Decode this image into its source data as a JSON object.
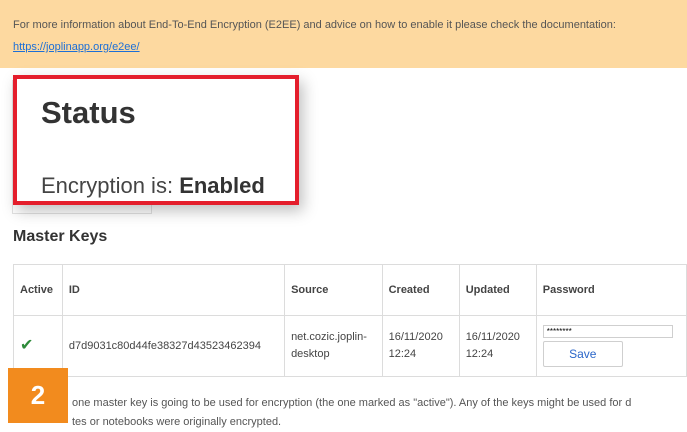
{
  "banner": {
    "text": "For more information about End-To-End Encryption (E2EE) and advice on how to enable it please check the documentation:",
    "link": "https://joplinapp.org/e2ee/"
  },
  "status": {
    "title": "Status",
    "encryption_label": "Encryption is:",
    "encryption_value": "Enabled"
  },
  "master_keys": {
    "title": "Master Keys",
    "columns": [
      "Active",
      "ID",
      "Source",
      "Created",
      "Updated",
      "Password"
    ],
    "row": {
      "active_icon": "check-icon",
      "active_glyph": "✔",
      "id": "d7d9031c80d44fe38327d435234623 94",
      "id_full": "d7d9031c80d44fe38327d43523462394",
      "source": "net.cozic.joplin-desktop",
      "created": "16/11/2020 12:24",
      "updated": "16/11/2020 12:24",
      "password_value": "********",
      "save_label": "Save"
    }
  },
  "footnote": {
    "line1": "one master key is going to be used for encryption (the one marked as \"active\"). Any of the keys might be used for d",
    "line2": "tes or notebooks were originally encrypted."
  },
  "badge": {
    "number": "2"
  },
  "colors": {
    "banner_bg": "#fdd9a0",
    "highlight_border": "#e41e2c",
    "badge_bg": "#f28b1e",
    "link": "#1d6fd6"
  }
}
